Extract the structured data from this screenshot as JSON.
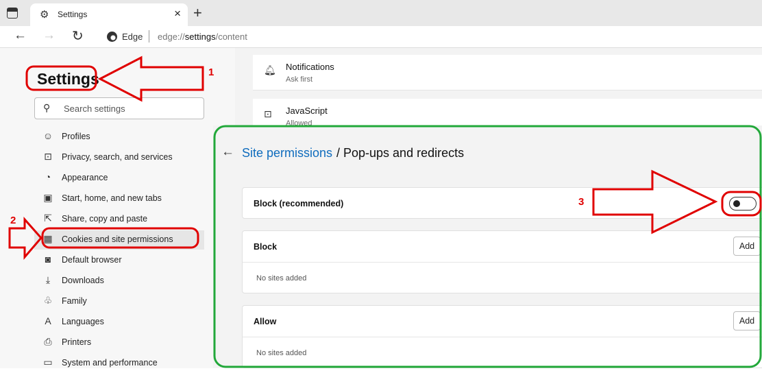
{
  "tab": {
    "title": "Settings",
    "icon": "gear-icon",
    "close_glyph": "×",
    "new_tab_glyph": "+"
  },
  "address_bar": {
    "brand": "Edge",
    "url_prefix": "edge://",
    "url_main": "settings",
    "url_suffix": "/content"
  },
  "sidebar": {
    "title": "Settings",
    "search_placeholder": "Search settings",
    "items": [
      {
        "label": "Profiles",
        "icon": "profile-icon",
        "glyph": "☺"
      },
      {
        "label": "Privacy, search, and services",
        "icon": "lock-icon",
        "glyph": "⊡"
      },
      {
        "label": "Appearance",
        "icon": "appearance-icon",
        "glyph": "◔"
      },
      {
        "label": "Start, home, and new tabs",
        "icon": "home-tabs-icon",
        "glyph": "▣"
      },
      {
        "label": "Share, copy and paste",
        "icon": "share-icon",
        "glyph": "⇱"
      },
      {
        "label": "Cookies and site permissions",
        "icon": "cookies-icon",
        "glyph": "▦",
        "active": true
      },
      {
        "label": "Default browser",
        "icon": "browser-icon",
        "glyph": "◙"
      },
      {
        "label": "Downloads",
        "icon": "download-icon",
        "glyph": "⤓"
      },
      {
        "label": "Family",
        "icon": "family-icon",
        "glyph": "♧"
      },
      {
        "label": "Languages",
        "icon": "languages-icon",
        "glyph": "A"
      },
      {
        "label": "Printers",
        "icon": "printer-icon",
        "glyph": "⎙"
      },
      {
        "label": "System and performance",
        "icon": "system-icon",
        "glyph": "▭"
      }
    ]
  },
  "background_rows": [
    {
      "title": "Notifications",
      "subtitle": "Ask first",
      "icon": "bell-icon",
      "glyph": "♫"
    },
    {
      "title": "JavaScript",
      "subtitle": "Allowed",
      "icon": "javascript-icon",
      "glyph": "⊠"
    }
  ],
  "panel": {
    "breadcrumb_link": "Site permissions",
    "breadcrumb_rest": "/ Pop-ups and redirects",
    "block_recommended": {
      "label": "Block (recommended)",
      "toggle_on": false
    },
    "block": {
      "label": "Block",
      "add_label": "Add",
      "empty_text": "No sites added"
    },
    "allow": {
      "label": "Allow",
      "add_label": "Add",
      "empty_text": "No sites added"
    }
  },
  "annotations": {
    "step1": "1",
    "step2": "2",
    "step3": "3",
    "color": "#e00000",
    "frame_color": "#22a83a"
  }
}
